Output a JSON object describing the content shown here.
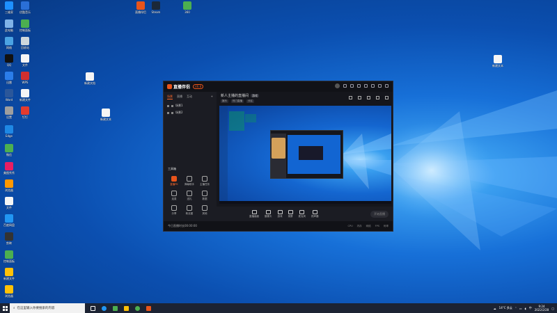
{
  "desktop": {
    "icons_left": [
      {
        "label": "三维家",
        "color": "#1e90ff"
      },
      {
        "label": "优酷音乐",
        "color": "#2a6fd6"
      },
      {
        "label": "此电脑",
        "color": "#7fb3e8"
      },
      {
        "label": "控制面板",
        "color": "#4caf50"
      },
      {
        "label": "网络",
        "color": "#4ba3e3"
      },
      {
        "label": "回收站",
        "color": "#cfd8dc"
      },
      {
        "label": "QQ",
        "color": "#111111"
      },
      {
        "label": "迅雷",
        "color": "#2b7de9"
      },
      {
        "label": "WPS",
        "color": "#d32f2f"
      },
      {
        "label": "Word",
        "color": "#2b579a"
      },
      {
        "label": "设置",
        "color": "#9e9e9e"
      },
      {
        "label": "钉钉",
        "color": "#e33b2e"
      },
      {
        "label": "Edge",
        "color": "#1e88e5"
      },
      {
        "label": "微信",
        "color": "#4caf50"
      },
      {
        "label": "美图秀秀",
        "color": "#e91e63"
      },
      {
        "label": "文件",
        "color": "#ffffff"
      },
      {
        "label": "百度网盘",
        "color": "#2196f3"
      },
      {
        "label": "剪映",
        "color": "#333333"
      },
      {
        "label": "浏览器",
        "color": "#ff9800"
      },
      {
        "label": "新建文件",
        "color": "#ffc107"
      }
    ],
    "icons_top": [
      {
        "label": "直播伴侣",
        "color": "#e8541b"
      },
      {
        "label": "Steam",
        "color": "#1b2838"
      },
      {
        "label": "360",
        "color": "#4caf50"
      }
    ],
    "icon_right": {
      "label": "新建文本",
      "color": "#ffffff"
    },
    "icons_mid": [
      {
        "label": "新建文档",
        "color": "#ffffff"
      },
      {
        "label": "新建文本",
        "color": "#ffffff"
      }
    ]
  },
  "app": {
    "name": "直播伴侣",
    "version": "V6.8",
    "left_tabs": [
      "场景",
      "直播",
      "互动"
    ],
    "scenes": [
      "场景1",
      "场景2"
    ],
    "tools_title": "工具箱",
    "tools": [
      {
        "label": "直播PK"
      },
      {
        "label": "弹幕助手"
      },
      {
        "label": "主播任务"
      },
      {
        "label": "连麦"
      },
      {
        "label": "送礼"
      },
      {
        "label": "数据"
      },
      {
        "label": "分享"
      },
      {
        "label": "粉丝团"
      },
      {
        "label": "其他"
      }
    ],
    "room_title": "新人主播的直播间",
    "room_tag": "游戏",
    "room_tags": [
      "娱乐",
      "热门直播",
      "分区"
    ],
    "controls": [
      {
        "label": "直播画面"
      },
      {
        "label": "摄像头"
      },
      {
        "label": "游戏"
      },
      {
        "label": "录屏"
      },
      {
        "label": "麦克风"
      },
      {
        "label": "扬声器"
      }
    ],
    "start_label": "开始直播",
    "status_left": "今日直播时长00:00:00",
    "status_right": [
      "CPU",
      "内存",
      "网络",
      "FPS",
      "码率"
    ]
  },
  "taskbar": {
    "search_placeholder": "在这里输入你要搜索的内容",
    "weather": "14°C 多云",
    "time": "9:24",
    "date": "2022/2/28",
    "lang": "中",
    "apps": [
      {
        "name": "task-view",
        "color": "#ffffff"
      },
      {
        "name": "edge",
        "color": "#2196f3"
      },
      {
        "name": "wechat",
        "color": "#4caf50"
      },
      {
        "name": "explorer",
        "color": "#ffc107"
      },
      {
        "name": "chrome",
        "color": "#4caf50"
      },
      {
        "name": "live",
        "color": "#e8541b"
      }
    ]
  }
}
